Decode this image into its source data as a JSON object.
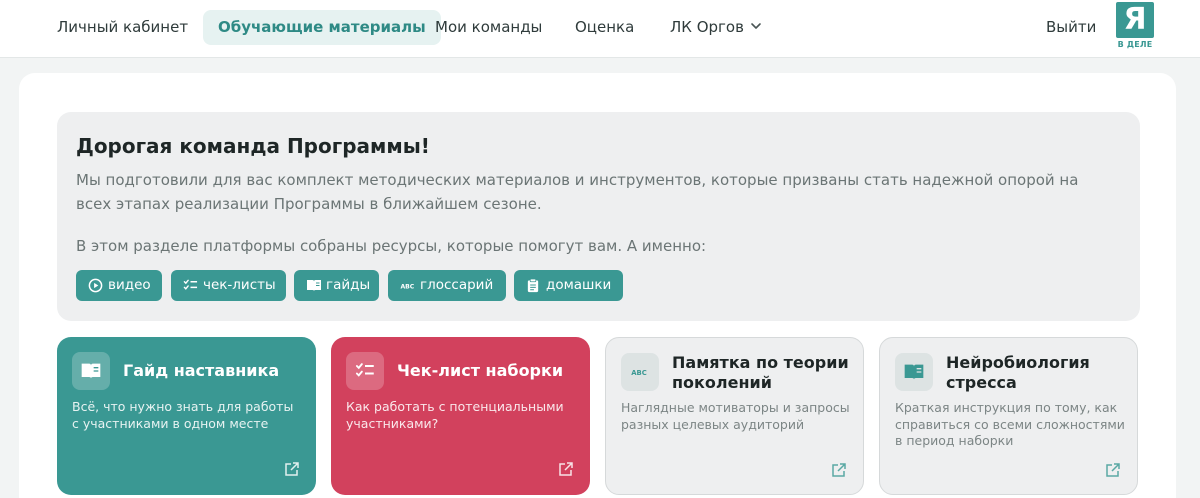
{
  "nav": {
    "items": [
      {
        "label": "Личный кабинет"
      },
      {
        "label": "Обучающие материалы",
        "active": true
      },
      {
        "label": "Мои команды"
      },
      {
        "label": "Оценка"
      },
      {
        "label": "ЛК Оргов",
        "dropdown": true
      }
    ],
    "logout_label": "Выйти",
    "logo_letter": "Я",
    "logo_sub": "В ДЕЛЕ"
  },
  "intro": {
    "title": "Дорогая команда Программы!",
    "paragraph1": "Мы подготовили для вас комплект методических материалов и инструментов, которые призваны стать надежной опорой на всех этапах реализации Программы в ближайшем сезоне.",
    "paragraph2": "В этом разделе платформы собраны ресурсы, которые помогут вам. А именно:",
    "tags": [
      {
        "label": "видео",
        "icon": "play-circle-icon"
      },
      {
        "label": "чек-листы",
        "icon": "checklist-icon"
      },
      {
        "label": "гайды",
        "icon": "book-icon"
      },
      {
        "label": "глоссарий",
        "icon": "abc-icon"
      },
      {
        "label": "домашки",
        "icon": "clipboard-icon"
      }
    ]
  },
  "cards": [
    {
      "title": "Гайд наставника",
      "description": "Всё, что нужно знать для работы с участниками в одном месте",
      "icon": "book-icon",
      "style": "teal"
    },
    {
      "title": "Чек-лист наборки",
      "description": "Как работать с потенциальными участниками?",
      "icon": "checklist-icon",
      "style": "red"
    },
    {
      "title": "Памятка по теории поколений",
      "description": "Наглядные мотиваторы и запросы разных целевых аудиторий",
      "icon": "abc-icon",
      "style": "grey"
    },
    {
      "title": "Нейробиология стресса",
      "description": "Краткая инструкция по тому, как справиться со всеми сложностями в период наборки",
      "icon": "book-icon",
      "style": "grey"
    }
  ],
  "colors": {
    "accent": "#3a9893",
    "red": "#d2415d",
    "panel": "#eeeff0"
  }
}
